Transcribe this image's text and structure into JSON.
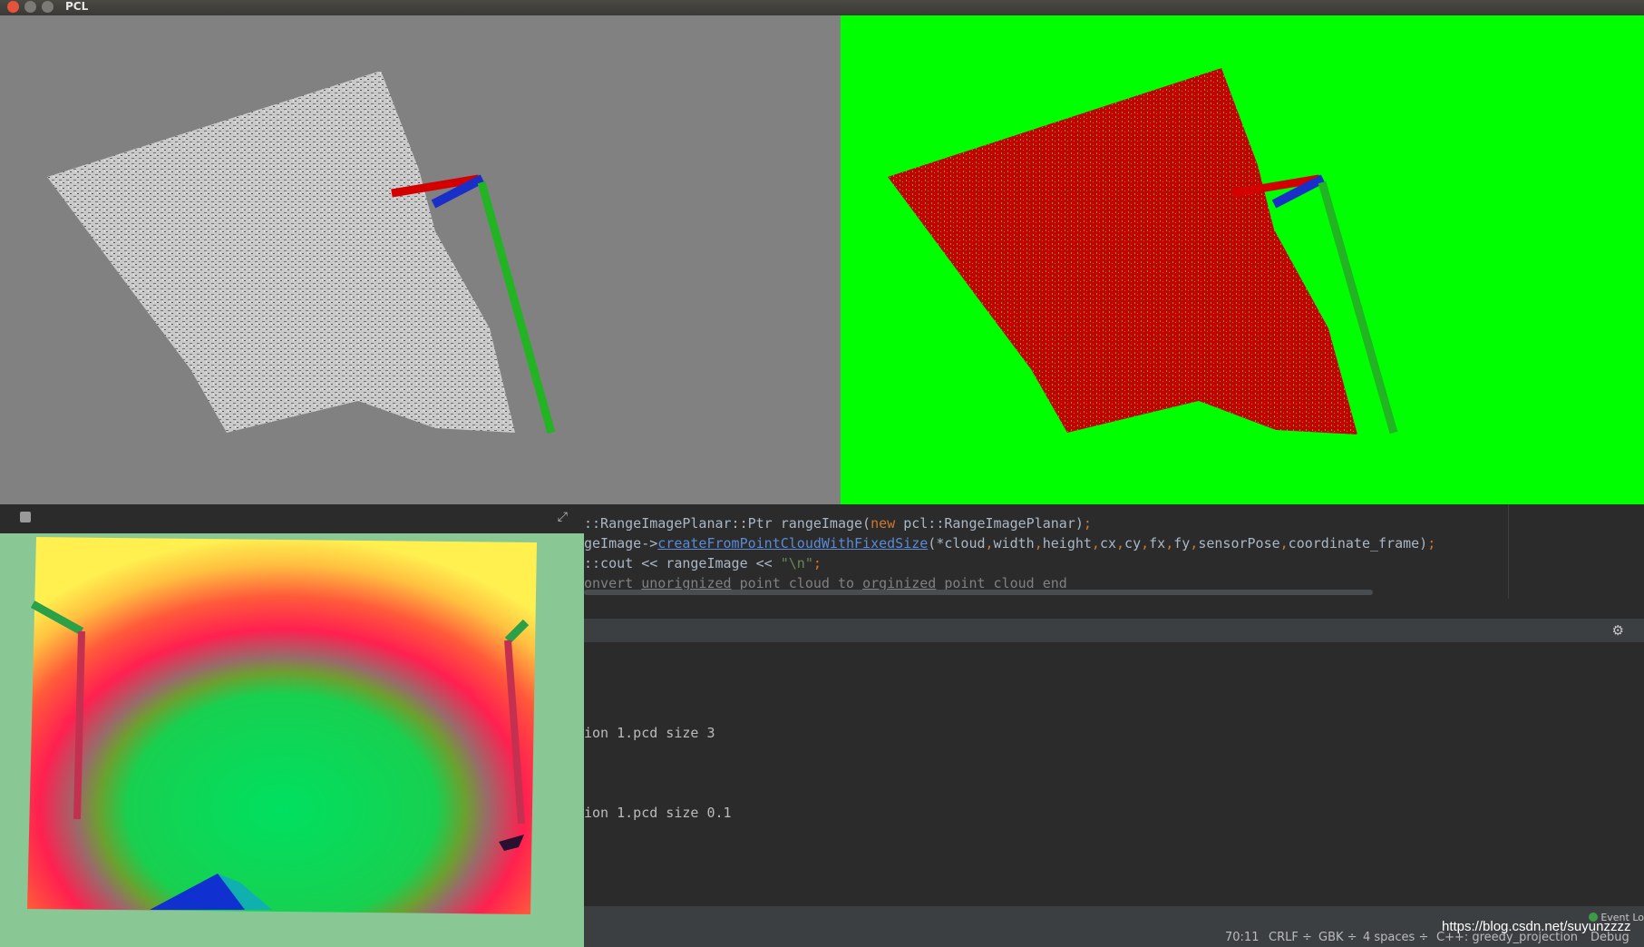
{
  "window": {
    "title": "PCL"
  },
  "colors": {
    "left_bg": "#818181",
    "right_bg": "#00ff00",
    "cloud_right": "#cc0000"
  },
  "editor": {
    "lines": [
      [
        {
          "t": "::RangeImagePlanar::Ptr rangeImage(",
          "c": ""
        },
        {
          "t": "new ",
          "c": "kw"
        },
        {
          "t": "pcl::RangeImagePlanar)",
          "c": ""
        },
        {
          "t": ";",
          "c": "kw"
        }
      ],
      [
        {
          "t": "geImage->",
          "c": ""
        },
        {
          "t": "createFromPointCloudWithFixedSize",
          "c": "link"
        },
        {
          "t": "(*cloud",
          "c": ""
        },
        {
          "t": ",",
          "c": "kw"
        },
        {
          "t": "width",
          "c": ""
        },
        {
          "t": ",",
          "c": "kw"
        },
        {
          "t": "height",
          "c": ""
        },
        {
          "t": ",",
          "c": "kw"
        },
        {
          "t": "cx",
          "c": ""
        },
        {
          "t": ",",
          "c": "kw"
        },
        {
          "t": "cy",
          "c": ""
        },
        {
          "t": ",",
          "c": "kw"
        },
        {
          "t": "fx",
          "c": ""
        },
        {
          "t": ",",
          "c": "kw"
        },
        {
          "t": "fy",
          "c": ""
        },
        {
          "t": ",",
          "c": "kw"
        },
        {
          "t": "sensorPose",
          "c": ""
        },
        {
          "t": ",",
          "c": "kw"
        },
        {
          "t": "coordinate_frame)",
          "c": ""
        },
        {
          "t": ";",
          "c": "kw"
        }
      ],
      [
        {
          "t": "::cout << rangeImage << ",
          "c": ""
        },
        {
          "t": "\"\\n\"",
          "c": "str"
        },
        {
          "t": ";",
          "c": "kw"
        }
      ],
      [
        {
          "t": "onvert ",
          "c": "comment"
        },
        {
          "t": "unorignized",
          "c": "comment ul"
        },
        {
          "t": " point cloud to ",
          "c": "comment"
        },
        {
          "t": "orginized",
          "c": "comment ul"
        },
        {
          "t": " point cloud end",
          "c": "comment"
        }
      ]
    ]
  },
  "console": {
    "lines": [
      "ion 1.pcd size 3",
      "ion 1.pcd size 0.1"
    ]
  },
  "status": {
    "position": "70:11",
    "line_sep": "CRLF ÷",
    "encoding": "GBK ÷",
    "indent": "4 spaces ÷",
    "context": "C++: greedy_projection",
    "config": "Debug",
    "event_log": "Event Lo"
  },
  "watermark": "https://blog.csdn.net/suyunzzzz",
  "icons": {
    "close": "close-icon",
    "minimize": "minimize-icon",
    "maximize": "maximize-icon",
    "pin": "pin-icon",
    "expand": "expand-icon",
    "gear": "gear-icon"
  }
}
